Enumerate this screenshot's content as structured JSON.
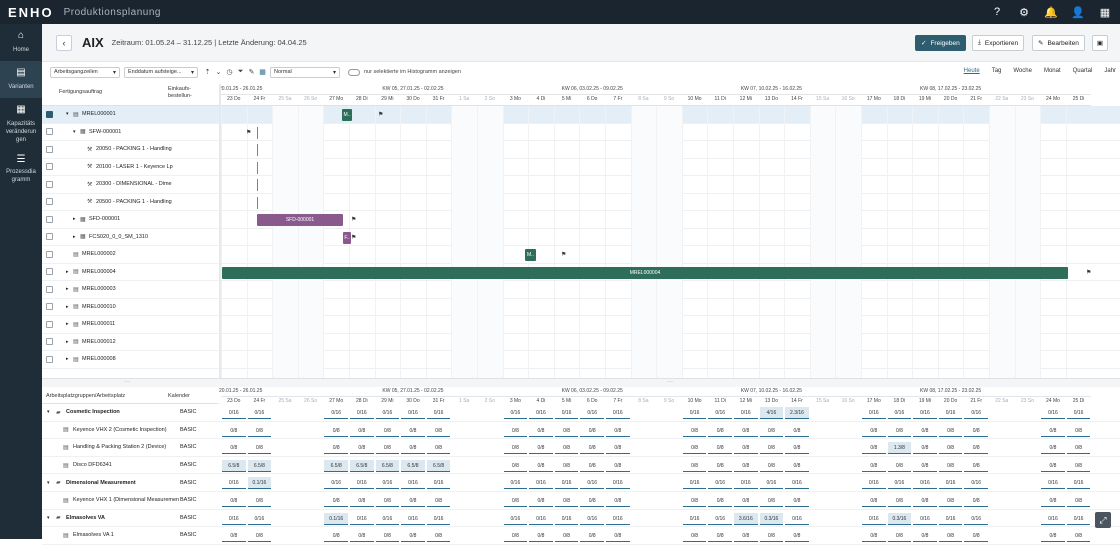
{
  "app": {
    "logo": "ENHO",
    "name": "Produktionsplanung"
  },
  "topicons": [
    "help-icon",
    "gear-icon",
    "bell-icon",
    "user-icon",
    "grid-apps-icon"
  ],
  "nav": [
    {
      "label": "Home",
      "icon": "home-icon"
    },
    {
      "label": "Varianten",
      "icon": "variants-icon",
      "active": true
    },
    {
      "label": "Kapazitäts veränderun gen",
      "icon": "capacity-icon"
    },
    {
      "label": "Prozessdia gramm",
      "icon": "process-icon"
    }
  ],
  "header": {
    "title": "AIX",
    "period": "Zeitraum: 01.05.24 – 31.12.25 | Letzte Änderung: 04.04.25",
    "release": "Freigeben",
    "export": "Exportieren",
    "edit": "Bearbeiten"
  },
  "toolbar": {
    "select1": "Arbeitsgangzeilen",
    "select2": "Enddatum aufsteige...",
    "select3": "Normal",
    "histogram": "nur selektierte im Histogramm anzeigen",
    "views": [
      "Heute",
      "Tag",
      "Woche",
      "Monat",
      "Quartal",
      "Jahr"
    ]
  },
  "top_table": {
    "col1": "Fertigungsauftrag",
    "col2": "Einkaufs-\nbestellun-",
    "rows": [
      {
        "label": "MREL000001",
        "level": 0,
        "type": "doc",
        "expand": true,
        "checked": true
      },
      {
        "label": "SFW-000001",
        "level": 1,
        "type": "grid",
        "expand": true
      },
      {
        "label": "20050 - PACKING 1 - Handling",
        "level": 2,
        "type": "tool"
      },
      {
        "label": "20100 - LASER 1 - Keyence Lp",
        "level": 2,
        "type": "tool"
      },
      {
        "label": "20300 - DIMENSIONAL - Dime",
        "level": 2,
        "type": "tool"
      },
      {
        "label": "20500 - PACKING 1 - Handling",
        "level": 2,
        "type": "tool"
      },
      {
        "label": "SFD-000001",
        "level": 1,
        "type": "grid",
        "expand": false
      },
      {
        "label": "FCS020_0_0_SM_1310",
        "level": 1,
        "type": "grid",
        "expand": false
      },
      {
        "label": "MREL000002",
        "level": 0,
        "type": "doc"
      },
      {
        "label": "MREL000004",
        "level": 0,
        "type": "doc",
        "expand": false
      },
      {
        "label": "MREL000003",
        "level": 0,
        "type": "doc",
        "expand": false
      },
      {
        "label": "MREL000010",
        "level": 0,
        "type": "doc",
        "expand": false
      },
      {
        "label": "MREL000011",
        "level": 0,
        "type": "doc",
        "expand": false
      },
      {
        "label": "MREL000012",
        "level": 0,
        "type": "doc",
        "expand": false
      },
      {
        "label": "MREL000008",
        "level": 0,
        "type": "doc",
        "expand": false
      }
    ]
  },
  "weeks": [
    "20.01.25 - 26.01.25",
    "KW 05, 27.01.25 - 02.02.25",
    "KW 06, 03.02.25 - 09.02.25",
    "KW 07, 10.02.25 - 16.02.25",
    "KW 08, 17.02.25 - 23.02.25"
  ],
  "days": [
    "23 Do",
    "24 Fr",
    "25 Sa",
    "26 So",
    "27 Mo",
    "28 Di",
    "29 Mi",
    "30 Do",
    "31 Fr",
    "1 Sa",
    "2 So",
    "3 Mo",
    "4 Di",
    "5 Mi",
    "6 Do",
    "7 Fr",
    "8 Sa",
    "9 So",
    "10 Mo",
    "11 Di",
    "12 Mi",
    "13 Do",
    "14 Fr",
    "15 Sa",
    "16 So",
    "17 Mo",
    "18 Di",
    "19 Mi",
    "20 Do",
    "21 Fr",
    "22 Sa",
    "23 So",
    "24 Mo",
    "25 Di"
  ],
  "bars": {
    "m1": "M..",
    "sfd": "SFD-000001",
    "f": "F..",
    "m2": "M..",
    "mrel4": "MREL000004"
  },
  "bottom_table": {
    "col1": "Arbeitsplatzgruppen/Arbeitsplatz",
    "col2": "Kalender",
    "rows": [
      {
        "label": "Cosmetic Inspection",
        "cal": "BASIC",
        "group": true,
        "vals": [
          "0/16",
          "0/16",
          "",
          "",
          "0/16",
          "0/16",
          "0/16",
          "0/16",
          "0/16",
          "",
          "",
          "0/16",
          "0/16",
          "0/16",
          "0/16",
          "0/16",
          "",
          "",
          "0/16",
          "0/16",
          "0/16",
          "4/16",
          "2.3/16",
          "",
          "",
          "0/16",
          "0/16",
          "0/16",
          "0/16",
          "0/16",
          "",
          "",
          "0/16",
          "0/16"
        ]
      },
      {
        "label": "Keyence VHX 2 (Cosmetic Inspection)",
        "cal": "BASIC",
        "vals": [
          "0/8",
          "0/8",
          "",
          "",
          "0/8",
          "0/8",
          "0/8",
          "0/8",
          "0/8",
          "",
          "",
          "0/8",
          "0/8",
          "0/8",
          "0/8",
          "0/8",
          "",
          "",
          "0/8",
          "0/8",
          "0/8",
          "0/8",
          "0/8",
          "",
          "",
          "0/8",
          "0/8",
          "0/8",
          "0/8",
          "0/8",
          "",
          "",
          "0/8",
          "0/8"
        ]
      },
      {
        "label": "Handling & Packing Station 2 (Device)",
        "cal": "BASIC",
        "vals": [
          "0/8",
          "0/8",
          "",
          "",
          "0/8",
          "0/8",
          "0/8",
          "0/8",
          "0/8",
          "",
          "",
          "0/8",
          "0/8",
          "0/8",
          "0/8",
          "0/8",
          "",
          "",
          "0/8",
          "0/8",
          "0/8",
          "0/8",
          "0/8",
          "",
          "",
          "0/8",
          "1.3/8",
          "0/8",
          "0/8",
          "0/8",
          "",
          "",
          "0/8",
          "0/8"
        ]
      },
      {
        "label": "Disco DFD6341",
        "cal": "BASIC",
        "vals": [
          "6.5/8",
          "6.5/8",
          "",
          "",
          "6.5/8",
          "6.5/8",
          "6.5/8",
          "6.5/8",
          "6.5/8",
          "",
          "",
          "0/8",
          "0/8",
          "0/8",
          "0/8",
          "0/8",
          "",
          "",
          "0/8",
          "0/8",
          "0/8",
          "0/8",
          "0/8",
          "",
          "",
          "0/8",
          "0/8",
          "0/8",
          "0/8",
          "0/8",
          "",
          "",
          "0/8",
          "0/8"
        ]
      },
      {
        "label": "Dimensional Measurement",
        "cal": "BASIC",
        "group": true,
        "vals": [
          "0/16",
          "0.1/16",
          "",
          "",
          "0/16",
          "0/16",
          "0/16",
          "0/16",
          "0/16",
          "",
          "",
          "0/16",
          "0/16",
          "0/16",
          "0/16",
          "0/16",
          "",
          "",
          "0/16",
          "0/16",
          "0/16",
          "0/16",
          "0/16",
          "",
          "",
          "0/16",
          "0/16",
          "0/16",
          "0/16",
          "0/16",
          "",
          "",
          "0/16",
          "0/16"
        ]
      },
      {
        "label": "Keyence VHX 1 (Dimensional Measurement)",
        "cal": "BASIC",
        "vals": [
          "0/8",
          "0/8",
          "",
          "",
          "0/8",
          "0/8",
          "0/8",
          "0/8",
          "0/8",
          "",
          "",
          "0/8",
          "0/8",
          "0/8",
          "0/8",
          "0/8",
          "",
          "",
          "0/8",
          "0/8",
          "0/8",
          "0/8",
          "0/8",
          "",
          "",
          "0/8",
          "0/8",
          "0/8",
          "0/8",
          "0/8",
          "",
          "",
          "0/8",
          "0/8"
        ]
      },
      {
        "label": "Elmasolves VA",
        "cal": "BASIC",
        "group": true,
        "vals": [
          "0/16",
          "0/16",
          "",
          "",
          "0.1/16",
          "0/16",
          "0/16",
          "0/16",
          "0/16",
          "",
          "",
          "0/16",
          "0/16",
          "0/16",
          "0/16",
          "0/16",
          "",
          "",
          "0/16",
          "0/16",
          "3.6/16",
          "0.3/16",
          "0/16",
          "",
          "",
          "0/16",
          "0.3/16",
          "0/16",
          "0/16",
          "0/16",
          "",
          "",
          "0/16",
          "0/16"
        ]
      },
      {
        "label": "Elmasolves VA 1",
        "cal": "BASIC",
        "vals": [
          "0/8",
          "0/8",
          "",
          "",
          "0/8",
          "0/8",
          "0/8",
          "0/8",
          "0/8",
          "",
          "",
          "0/8",
          "0/8",
          "0/8",
          "0/8",
          "0/8",
          "",
          "",
          "0/8",
          "0/8",
          "0/8",
          "0/8",
          "0/8",
          "",
          "",
          "0/8",
          "0/8",
          "0/8",
          "0/8",
          "0/8",
          "",
          "",
          "0/8",
          "0/8"
        ]
      }
    ]
  }
}
